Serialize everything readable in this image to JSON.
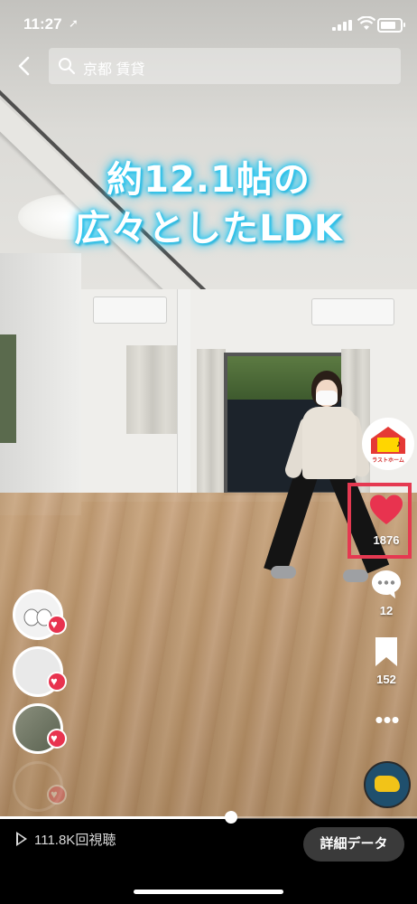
{
  "status_bar": {
    "time": "11:27",
    "location_icon": "location-arrow-icon",
    "signal_icon": "cellular-signal-icon",
    "wifi_icon": "wifi-icon",
    "battery_icon": "battery-icon"
  },
  "search": {
    "back_icon": "chevron-left-icon",
    "query": "京都 賃貸",
    "search_icon": "search-icon"
  },
  "video": {
    "caption_line1": "約12.1帖の",
    "caption_line2": "広々としたLDK",
    "caption_glow_color": "#36c9f0"
  },
  "actions": {
    "like_count": "1876",
    "comment_count": "12",
    "bookmark_count": "152",
    "like_color": "#e8334f",
    "highlight_color": "#e53951"
  },
  "creator_avatar": {
    "text": "ラストホーム"
  },
  "progress": {
    "played_fraction": 0.555
  },
  "bottom": {
    "views_label": "111.8K回視聴",
    "detail_button": "詳細データ"
  }
}
